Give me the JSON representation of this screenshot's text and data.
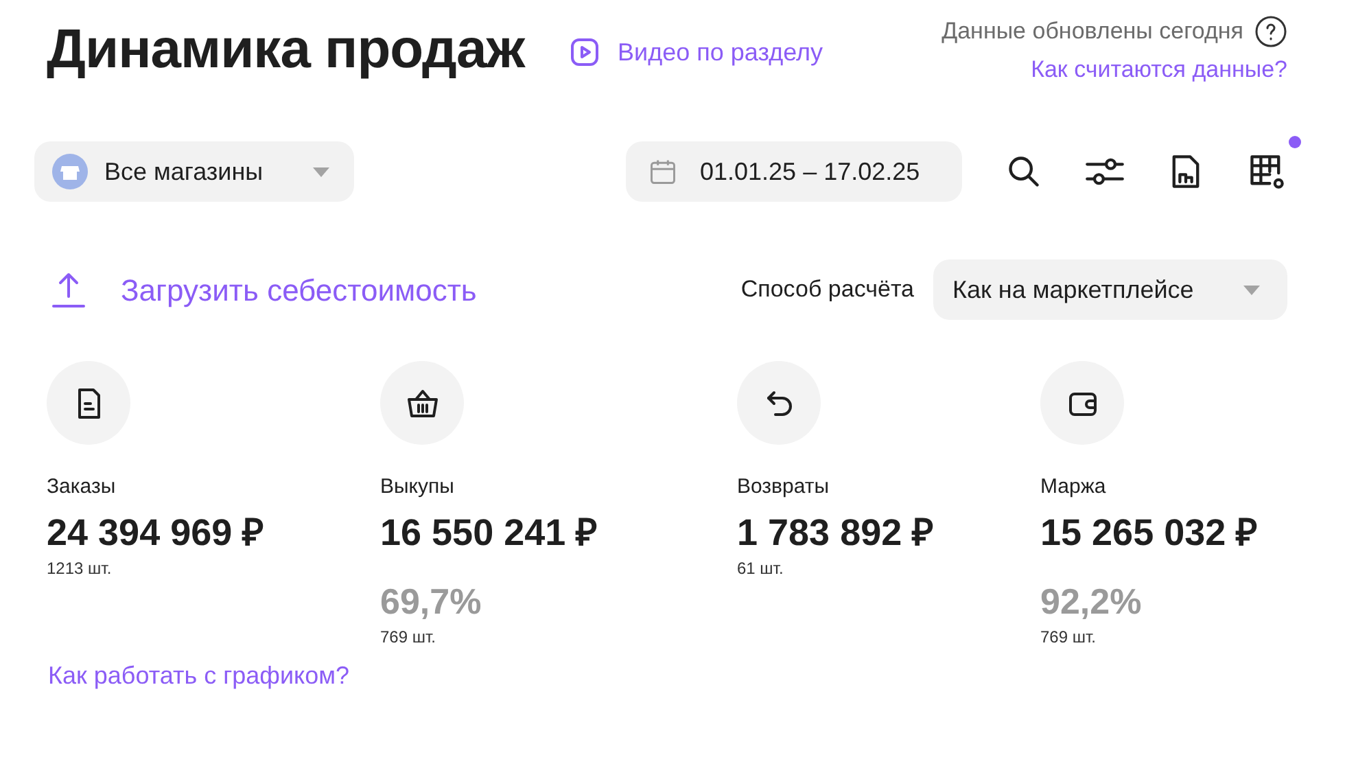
{
  "header": {
    "title": "Динамика продаж",
    "video_link": "Видео по разделу",
    "updated": "Данные обновлены сегодня",
    "help_link": "Как считаются данные?"
  },
  "toolbar": {
    "store_select": {
      "value": "Все магазины"
    },
    "date_range": {
      "value": "01.01.25 – 17.02.25"
    },
    "tools": [
      {
        "kind": "search",
        "dot": false
      },
      {
        "kind": "filters",
        "dot": false
      },
      {
        "kind": "report",
        "dot": false
      },
      {
        "kind": "table-settings",
        "dot": true
      }
    ]
  },
  "upload": {
    "label": "Загрузить себестоимость"
  },
  "calc_method": {
    "label": "Способ расчёта",
    "value": "Как на маркетплейсе"
  },
  "metrics": [
    {
      "kind": "orders",
      "label": "Заказы",
      "amount": "24 394 969 ₽",
      "count": "1213 шт."
    },
    {
      "kind": "buyouts",
      "label": "Выкупы",
      "amount": "16 550 241 ₽",
      "percent": "69,7%",
      "percent_count": "769 шт."
    },
    {
      "kind": "returns",
      "label": "Возвраты",
      "amount": "1 783 892 ₽",
      "count": "61 шт."
    },
    {
      "kind": "margin",
      "label": "Маржа",
      "amount": "15 265 032 ₽",
      "percent": "92,2%",
      "percent_count": "769 шт."
    }
  ],
  "chart_help_link": "Как работать с графиком?"
}
